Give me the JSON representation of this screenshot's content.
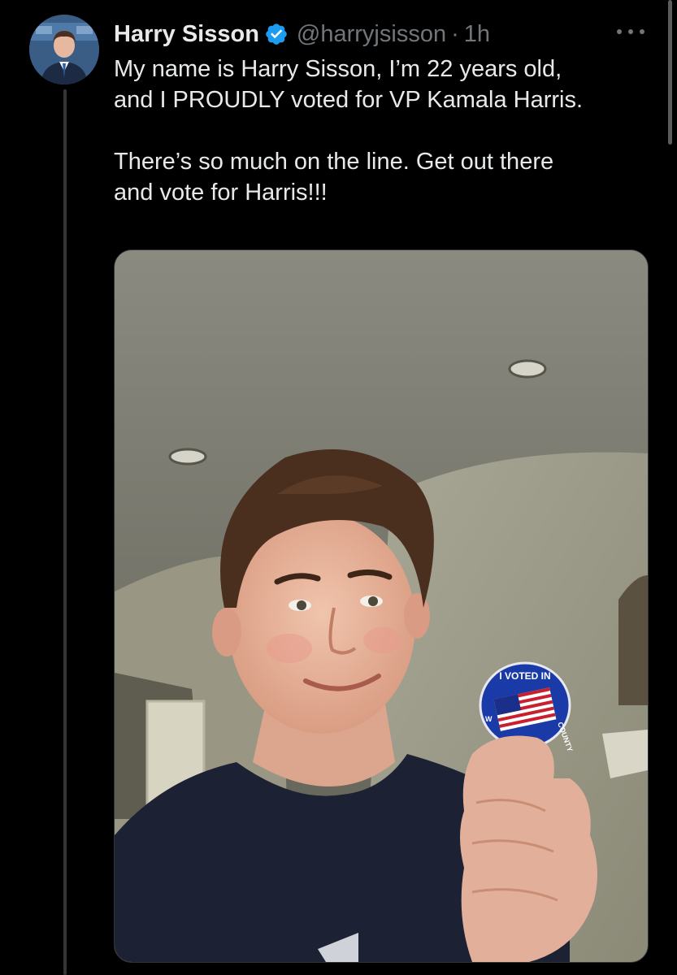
{
  "tweet": {
    "author_name": "Harry Sisson",
    "handle": "@harryjsisson",
    "separator": "·",
    "time": "1h",
    "text": "My name is Harry Sisson, I’m 22 years old,\nand I PROUDLY voted for VP Kamala Harris.\n\nThere’s so much on the line. Get out there\nand vote for Harris!!!",
    "verified": true
  },
  "sticker": {
    "top_text": "I VOTED IN",
    "right_text": "COUNTY",
    "left_text": "W"
  },
  "icons": {
    "verified": "verified-badge-icon",
    "more": "more-horizontal-icon"
  },
  "colors": {
    "background": "#000000",
    "text": "#e7e9ea",
    "muted": "#71767b",
    "verified": "#1d9bf0"
  }
}
